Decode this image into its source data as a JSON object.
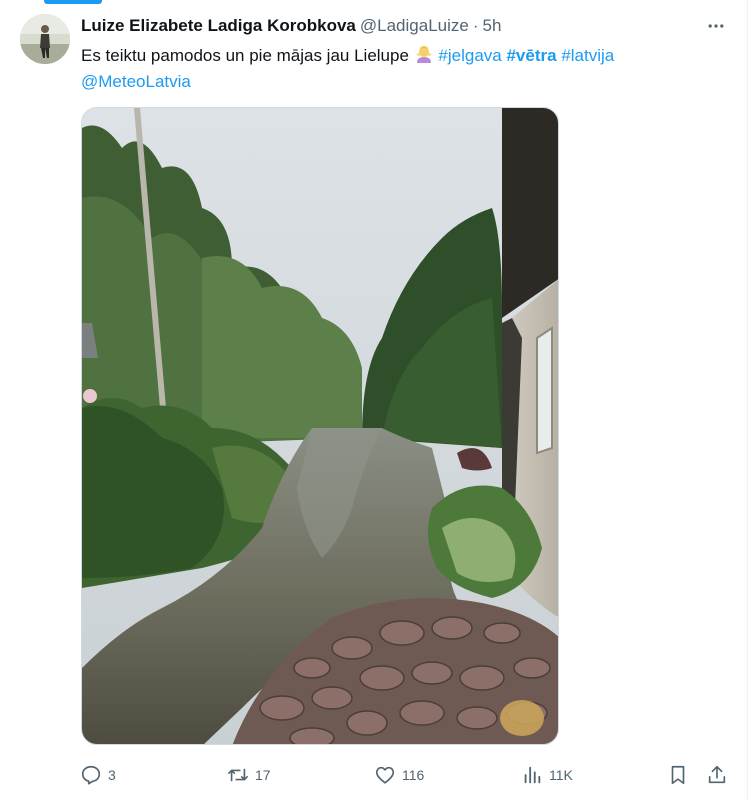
{
  "tweet": {
    "author_name": "Luize Elizabete Ladiga Korobkova",
    "handle": "@LadigaLuize",
    "separator": "·",
    "time": "5h",
    "text_main": "Es teiktu pamodos un pie mājas jau Lielupe",
    "emoji": "person-shrugging-emoji",
    "hashtag_1": "#jelgava",
    "hashtag_2": "#vētra",
    "hashtag_3": "#latvija",
    "mention": "@MeteoLatvia"
  },
  "media": {
    "description_icon": "flooded-garden-photo"
  },
  "actions": {
    "reply_count": "3",
    "retweet_count": "17",
    "like_count": "116",
    "views_count": "11K"
  },
  "colors": {
    "accent": "#1d9bf0",
    "secondary_text": "#536471",
    "primary_text": "#0f1419"
  }
}
